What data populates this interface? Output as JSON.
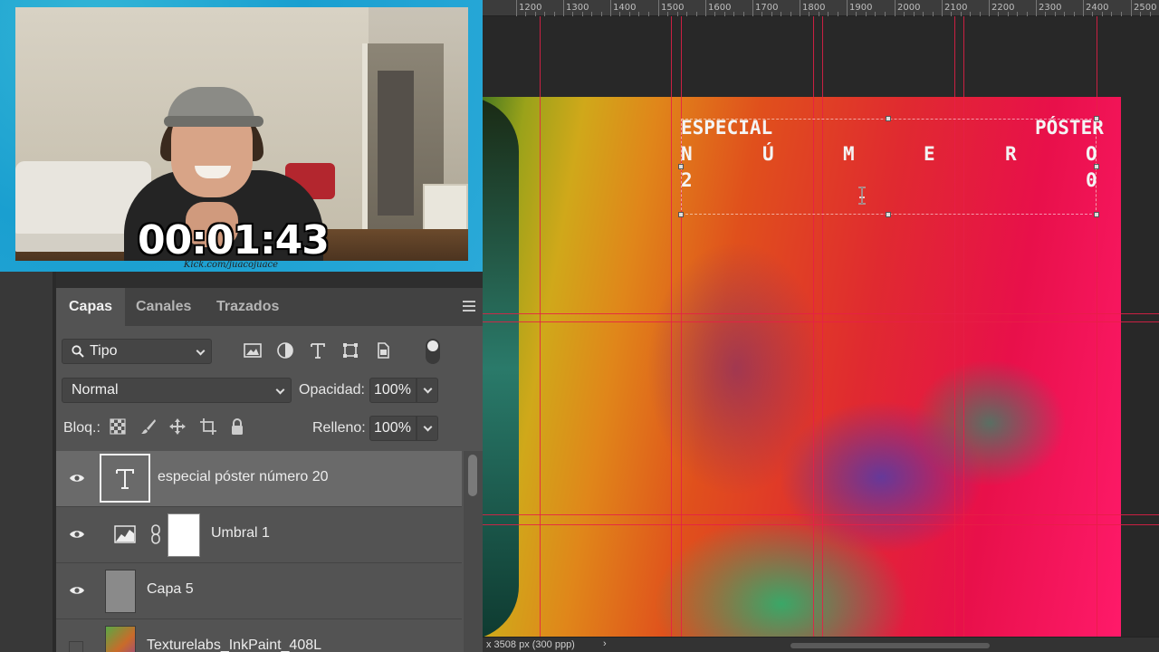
{
  "webcam": {
    "timer": "00:01:43",
    "credit": "Kick.com/juacojuace"
  },
  "layers_panel": {
    "tabs": [
      "Capas",
      "Canales",
      "Trazados"
    ],
    "filter": {
      "value": "Tipo"
    },
    "blend_mode": "Normal",
    "opacity_label": "Opacidad:",
    "opacity_value": "100%",
    "lock_label": "Bloq.:",
    "fill_label": "Relleno:",
    "fill_value": "100%",
    "layers": [
      {
        "name": "especial  póster  número  20",
        "type": "text",
        "visible": true,
        "selected": true
      },
      {
        "name": "Umbral 1",
        "type": "adjustment",
        "visible": true,
        "selected": false
      },
      {
        "name": "Capa 5",
        "type": "pixel",
        "visible": true,
        "selected": false
      },
      {
        "name": "Texturelabs_InkPaint_408L",
        "type": "image",
        "visible": false,
        "selected": false
      }
    ]
  },
  "canvas": {
    "ruler_labels": [
      "1200",
      "1300",
      "1400",
      "1500",
      "1600",
      "1700",
      "1800",
      "1900",
      "2000",
      "2100",
      "2200",
      "2300",
      "2400",
      "2500"
    ],
    "poster_text": {
      "left_line1": "ESPECIAL",
      "right_line1": "PÓSTER",
      "line2": [
        "N",
        "Ú",
        "M",
        "E",
        "R",
        "O"
      ],
      "line3_left": "2",
      "line3_right": "0"
    },
    "status": "x 3508 px (300 ppp)",
    "status_arrow": "›"
  },
  "colors": {
    "panel_bg": "#535353",
    "guide": "#e61e46",
    "selected_layer": "#6a6a6a"
  }
}
